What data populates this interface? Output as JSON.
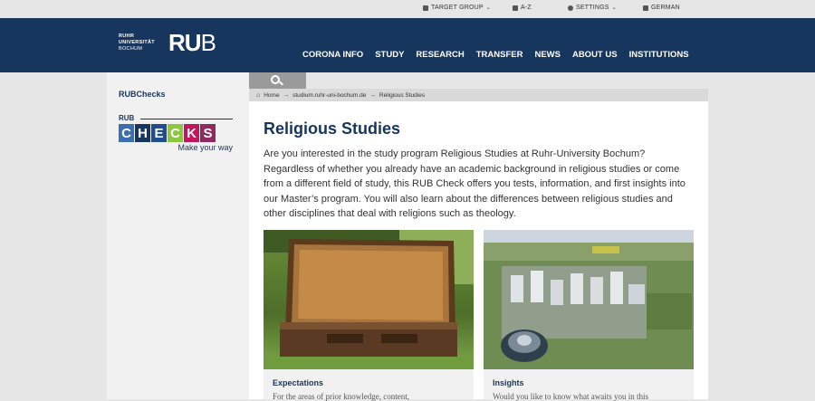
{
  "topbar": {
    "target_group": "TARGET GROUP",
    "az": "A-Z",
    "settings": "SETTINGS",
    "language": "GERMAN"
  },
  "header": {
    "logo_line1": "RUHR",
    "logo_line2": "UNIVERSITÄT",
    "logo_line3": "BOCHUM",
    "logo_ru": "RU",
    "logo_b": "B",
    "nav": [
      "CORONA INFO",
      "STUDY",
      "RESEARCH",
      "TRANSFER",
      "NEWS",
      "ABOUT US",
      "INSTITUTIONS"
    ]
  },
  "sidebar": {
    "title": "RUBChecks",
    "logo_rub": "RUB",
    "logo_letters": [
      "C",
      "H",
      "E",
      "C",
      "K",
      "S"
    ],
    "logo_tagline": "Make your way"
  },
  "breadcrumb": {
    "items": [
      "Home",
      "studium.ruhr-uni-bochum.de",
      "Religious Studies"
    ],
    "sep": "→"
  },
  "main": {
    "title": "Religious Studies",
    "intro": "Are you interested in the study program Religious Studies at Ruhr-University Bochum? Regardless of whether you already have an academic background in religious studies or come from a different field of study, this RUB Check offers you tests, information, and first insights into our Master’s program. You will also learn about the differences between religious studies and other disciplines that deal with religions such as theology.",
    "cards": [
      {
        "title": "Expectations",
        "text": "For the areas of prior knowledge, content,"
      },
      {
        "title": "Insights",
        "text": "Would you like to know what awaits you in this"
      }
    ]
  },
  "colors": {
    "navy": "#17365d",
    "checks": [
      "#3a6fb0",
      "#17365d",
      "#1f4e8c",
      "#8dc63f",
      "#c2185b",
      "#8e2a5f"
    ]
  }
}
